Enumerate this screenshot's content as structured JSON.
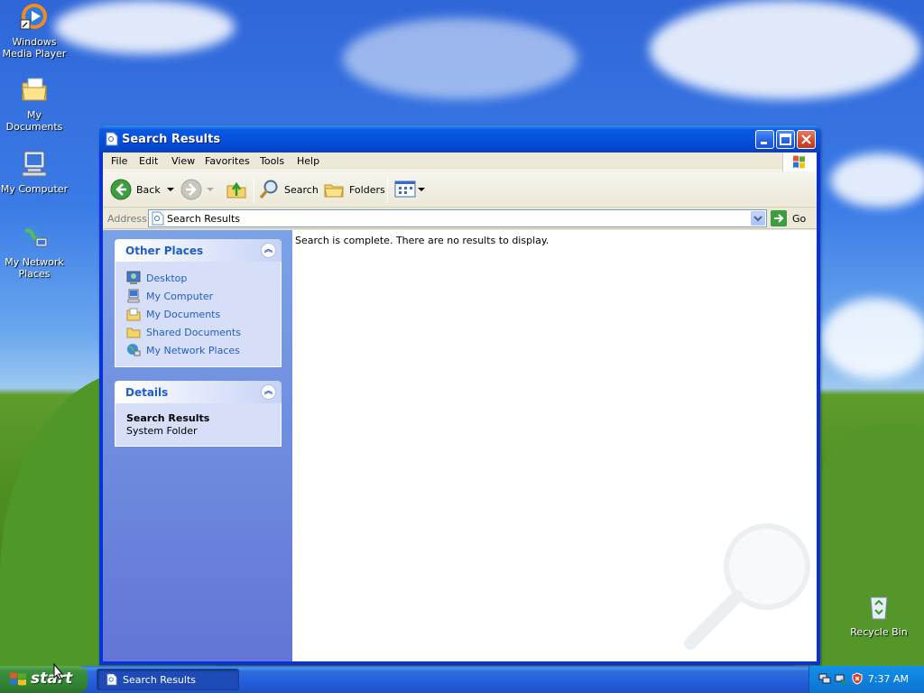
{
  "desktop": {
    "icons": [
      {
        "label": "Windows Media Player"
      },
      {
        "label": "My Documents"
      },
      {
        "label": "My Computer"
      },
      {
        "label": "My Network Places"
      },
      {
        "label": "Recycle Bin"
      }
    ]
  },
  "window": {
    "title": "Search Results",
    "menu": [
      "File",
      "Edit",
      "View",
      "Favorites",
      "Tools",
      "Help"
    ],
    "toolbar": {
      "back_label": "Back",
      "search_label": "Search",
      "folders_label": "Folders"
    },
    "address": {
      "label": "Address",
      "value": "Search Results",
      "go_label": "Go"
    },
    "other_places": {
      "title": "Other Places",
      "items": [
        {
          "label": "Desktop"
        },
        {
          "label": "My Computer"
        },
        {
          "label": "My Documents"
        },
        {
          "label": "Shared Documents"
        },
        {
          "label": "My Network Places"
        }
      ]
    },
    "details": {
      "title": "Details",
      "name": "Search Results",
      "type": "System Folder"
    },
    "content": {
      "message": "Search is complete. There are no results to display."
    }
  },
  "taskbar": {
    "start_label": "start",
    "task_label": "Search Results",
    "clock": "7:37 AM"
  },
  "colors": {
    "title_blue": "#0651dd",
    "link_blue": "#215dc6",
    "start_green": "#318331"
  }
}
